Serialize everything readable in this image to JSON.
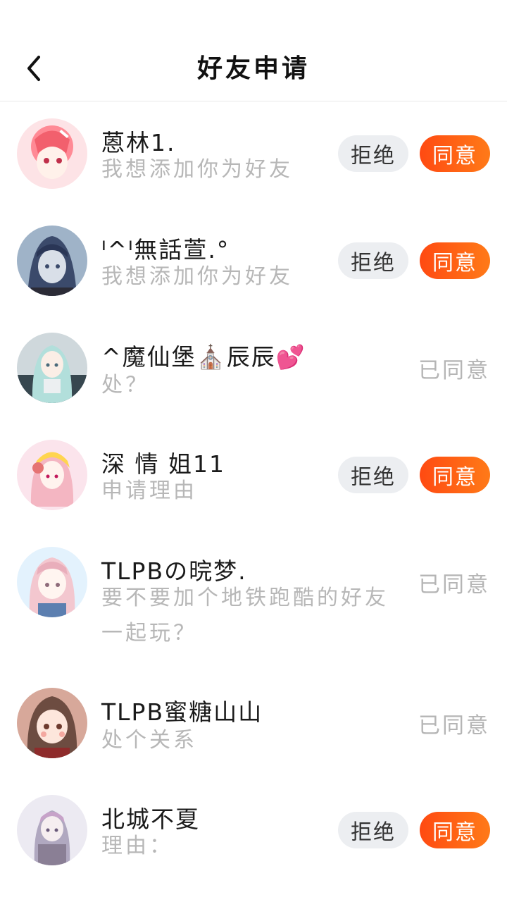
{
  "header": {
    "title": "好友申请",
    "back_icon": "chevron-left-icon"
  },
  "colors": {
    "accent": "#ff5a14",
    "reject_bg": "#eceef1",
    "muted": "#b7b7b7"
  },
  "requests": [
    {
      "name": "蒽林1.",
      "reason": "我想添加你为好友",
      "status": "pending",
      "reject_label": "拒绝",
      "accept_label": "同意"
    },
    {
      "name": "ᑊ^ᑊ無話萱.°",
      "reason": "我想添加你为好友",
      "status": "pending",
      "reject_label": "拒绝",
      "accept_label": "同意"
    },
    {
      "name": "^魔仙堡⛪辰辰💕",
      "reason": "处？",
      "status": "agreed",
      "status_label": "已同意"
    },
    {
      "name": "深  情  姐11",
      "reason": "申请理由",
      "status": "pending",
      "reject_label": "拒绝",
      "accept_label": "同意"
    },
    {
      "name": "TLPBの晥梦.",
      "reason": "要不要加个地铁跑酷的好友一起玩？",
      "status": "agreed",
      "status_label": "已同意"
    },
    {
      "name": "TLPB蜜糖山山",
      "reason": "处个关系",
      "status": "agreed",
      "status_label": "已同意"
    },
    {
      "name": "北城不夏",
      "reason": "理由：",
      "status": "pending",
      "reject_label": "拒绝",
      "accept_label": "同意"
    }
  ]
}
